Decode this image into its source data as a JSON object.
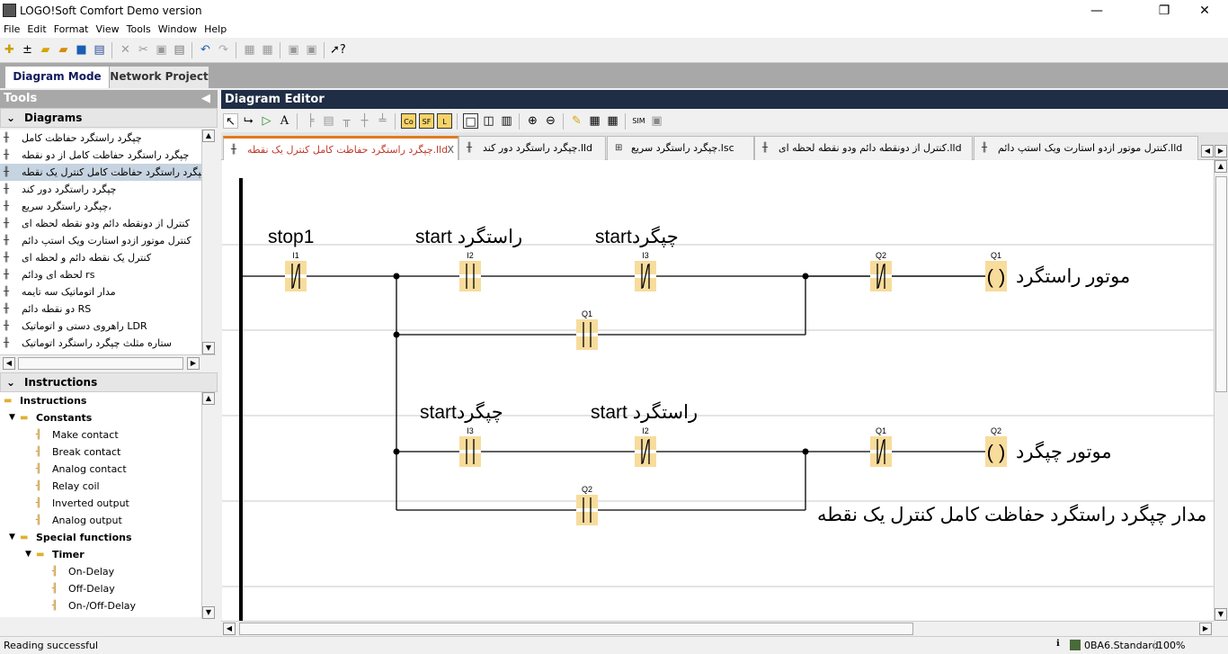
{
  "window": {
    "title": "LOGO!Soft Comfort Demo version",
    "minimize": "—",
    "maximize": "❐",
    "close": "✕"
  },
  "menu": [
    "File",
    "Edit",
    "Format",
    "View",
    "Tools",
    "Window",
    "Help"
  ],
  "mode_tabs": [
    "Diagram Mode",
    "Network Project"
  ],
  "tools_panel": {
    "title": "Tools",
    "diagrams_header": "Diagrams",
    "diagrams": [
      "چپگرد راستگرد حفاظت کامل",
      "چپگرد راستگرد حفاظت کامل از دو نقطه",
      "چپگرد راستگرد حفاظت کامل کنترل یک نقطه",
      "چپگرد راستگرد دور کند",
      "چپگرد راستگرد سریع،",
      "کنترل از دونقطه دائم ودو نقطه لحظه ای",
      "کنترل موتور ازدو استارت ویک استپ  دائم",
      "کنترل یک نقطه دائم و لحظه ای",
      "لحظه ای ودائم  rs",
      "مدار اتوماتیک  سه تایمه",
      "دو نقطه دائم RS",
      "راهروی دستی و اتوماتیک  LDR",
      "ستاره مثلث چپگرد راستگرد اتوماتیک"
    ],
    "selected_diagram": 2,
    "instructions_header": "Instructions",
    "tree": [
      {
        "label": "Instructions",
        "level": 0,
        "type": "folder",
        "bold": true
      },
      {
        "label": "Constants",
        "level": 1,
        "type": "folder",
        "bold": true
      },
      {
        "label": "Make contact",
        "level": 2,
        "type": "make-contact"
      },
      {
        "label": "Break contact",
        "level": 2,
        "type": "break-contact"
      },
      {
        "label": "Analog contact",
        "level": 2,
        "type": "analog-contact"
      },
      {
        "label": "Relay coil",
        "level": 2,
        "type": "relay-coil"
      },
      {
        "label": "Inverted output",
        "level": 2,
        "type": "inverted-output"
      },
      {
        "label": "Analog output",
        "level": 2,
        "type": "analog-output"
      },
      {
        "label": "Special functions",
        "level": 1,
        "type": "folder",
        "bold": true
      },
      {
        "label": "Timer",
        "level": 2,
        "type": "folder",
        "bold": true
      },
      {
        "label": "On-Delay",
        "level": 3,
        "type": "timer"
      },
      {
        "label": "Off-Delay",
        "level": 3,
        "type": "timer"
      },
      {
        "label": "On-/Off-Delay",
        "level": 3,
        "type": "timer"
      }
    ]
  },
  "editor": {
    "title": "Diagram Editor",
    "file_tabs": [
      "چپگرد راستگرد حفاظت کامل کنترل یک نقطه.lld",
      "چپگرد راستگرد دور کند.lld",
      "چپگرد راستگرد سریع.lsc",
      "کنترل از دونقطه دائم ودو نقطه لحظه ای.lld",
      "کنترل موتور ازدو استارت ویک استپ  دائم.lld"
    ],
    "active_tab": 0,
    "tab_close": "X"
  },
  "diagram": {
    "comments": {
      "stop1": "stop1",
      "start_right_1": "start راستگرد",
      "start_left_1": "startچپگرد",
      "motor_right": "موتور راستگرد",
      "start_left_2": "startچپگرد",
      "start_right_2": "start راستگرد",
      "motor_left": "موتور چپگرد",
      "circuit_title": "مدار چپگرد راستگرد حفاظت کامل کنترل یک نقطه"
    },
    "rung1": {
      "I1": {
        "label": "I1",
        "type": "break"
      },
      "I2": {
        "label": "I2",
        "type": "make"
      },
      "I3": {
        "label": "I3",
        "type": "break"
      },
      "Q2": {
        "label": "Q2",
        "type": "break"
      },
      "Q1_hold": {
        "label": "Q1",
        "type": "make"
      },
      "coil": {
        "label": "Q1",
        "type": "coil",
        "symbol": "( )"
      }
    },
    "rung2": {
      "I3": {
        "label": "I3",
        "type": "make"
      },
      "I2": {
        "label": "I2",
        "type": "break"
      },
      "Q1": {
        "label": "Q1",
        "type": "break"
      },
      "Q2_hold": {
        "label": "Q2",
        "type": "make"
      },
      "coil": {
        "label": "Q2",
        "type": "coil",
        "symbol": "( )"
      }
    },
    "contact_color": "#f7dc9c"
  },
  "status": {
    "message": "Reading successful",
    "device": "0BA6.Standard",
    "zoom": "100%"
  }
}
